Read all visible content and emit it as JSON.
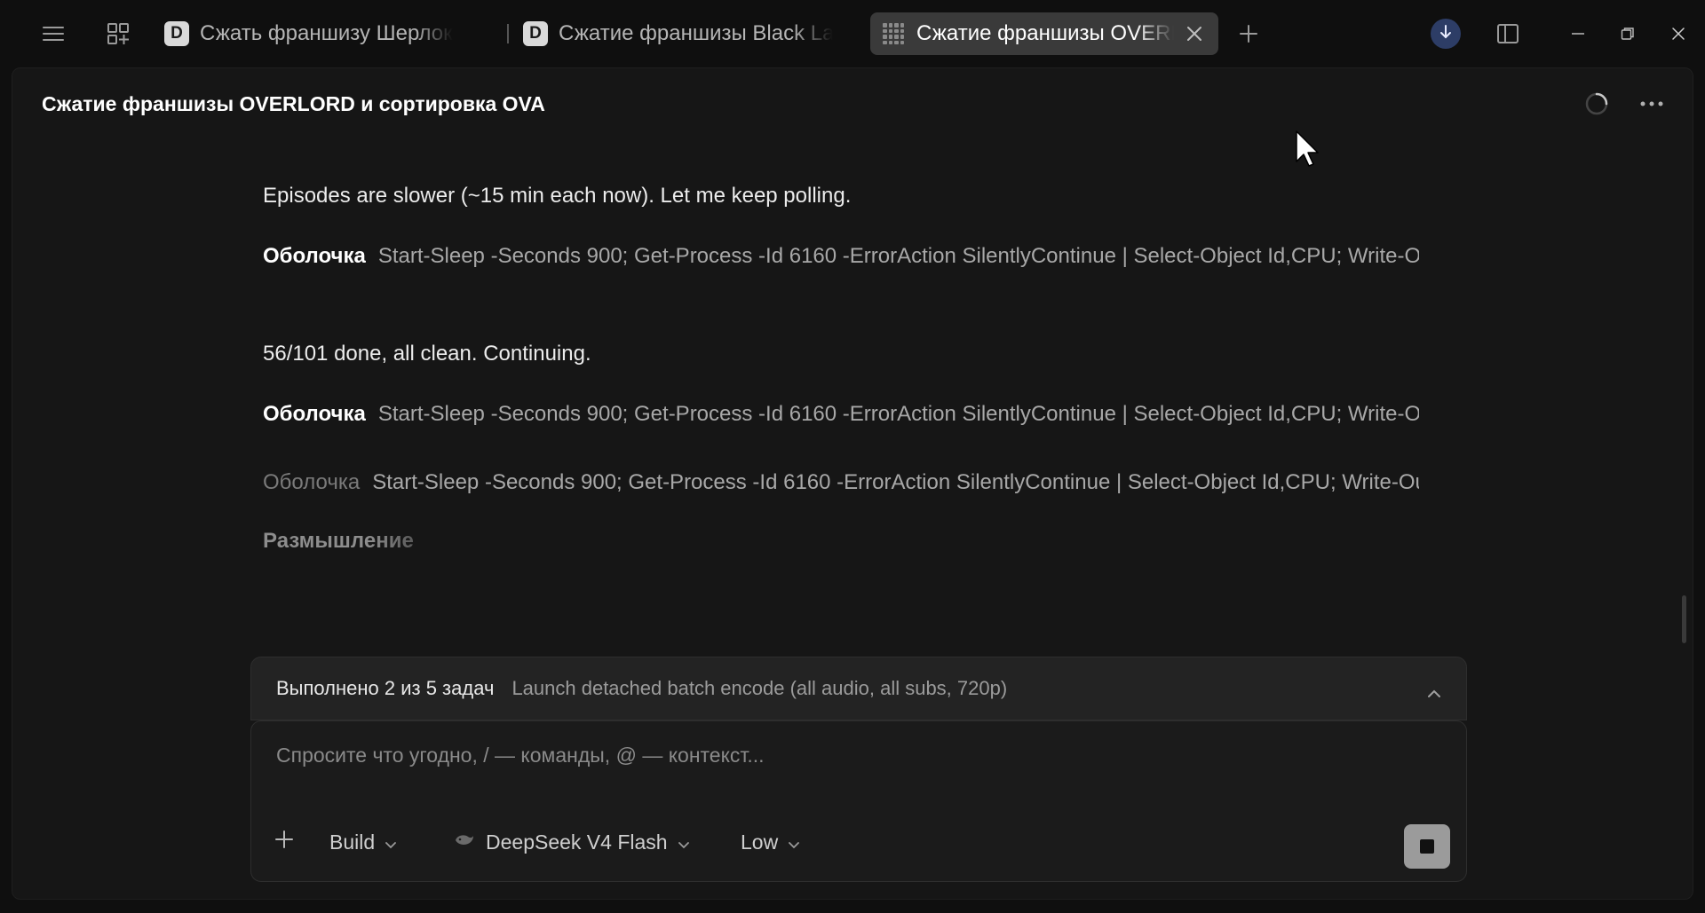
{
  "tabs": [
    {
      "favicon": "D",
      "title": "Сжать франшизу Шерлок",
      "active": false
    },
    {
      "favicon": "D",
      "title": "Сжатие франшизы Black Lagoon",
      "active": false
    },
    {
      "favicon": "",
      "title": "Сжатие франшизы OVERLORD и сортировка OVA",
      "active": true
    }
  ],
  "panel": {
    "title": "Сжатие франшизы OVERLORD и сортировка OVA"
  },
  "messages": {
    "m1": "Episodes are slower (~15 min each now). Let me keep polling.",
    "m2": "56/101 done, all clean. Continuing."
  },
  "commands": [
    {
      "label": "Оболочка",
      "text": "Start-Sleep -Seconds 900; Get-Process -Id 6160 -ErrorAction SilentlyContinue | Select-Object Id,CPU; Write-Output"
    },
    {
      "label": "Оболочка",
      "text": "Start-Sleep -Seconds 900; Get-Process -Id 6160 -ErrorAction SilentlyContinue | Select-Object Id,CPU; Write-Output"
    },
    {
      "label": "Оболочка",
      "text": "Start-Sleep -Seconds 900; Get-Process -Id 6160 -ErrorAction SilentlyContinue | Select-Object Id,CPU; Write-Output"
    }
  ],
  "thinking_label": "Размышление",
  "tasks": {
    "count_label": "Выполнено 2 из 5 задач",
    "current": "Launch detached batch encode (all audio, all subs, 720p)"
  },
  "composer": {
    "placeholder": "Спросите что угодно, / — команды, @ — контекст...",
    "value": "",
    "mode": "Build",
    "model": "DeepSeek V4 Flash",
    "effort": "Low"
  },
  "icons": {
    "menu": "hamburger-icon",
    "workspaces": "grid-plus-icon",
    "new_tab": "plus-icon",
    "download": "arrow-down-icon",
    "sidebar": "sidebar-toggle-icon",
    "spinner": "loading-spinner-icon",
    "more": "ellipsis-icon",
    "stop": "stop-icon"
  },
  "colors": {
    "background": "#0f0f0f",
    "panel": "#161616",
    "active_tab": "#3a3a3a",
    "download_badge": "#2d3d66"
  }
}
